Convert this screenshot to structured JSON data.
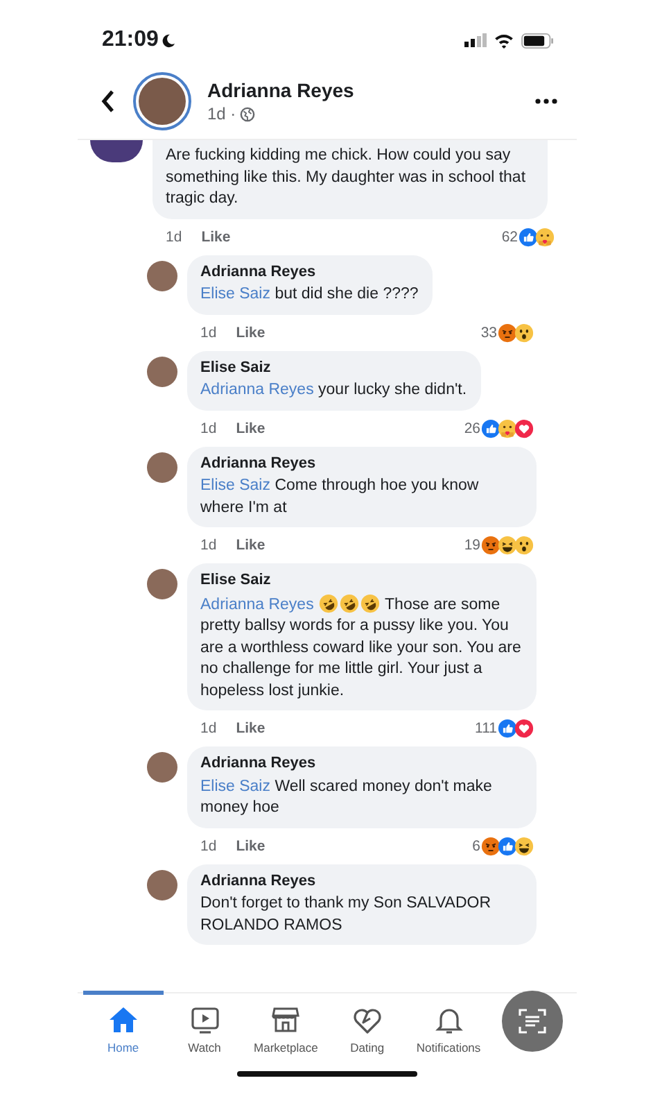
{
  "status_bar": {
    "time": "21:09"
  },
  "header": {
    "name": "Adrianna Reyes",
    "meta": "1d ·"
  },
  "comments": [
    {
      "kind": "comment",
      "text": "Are fucking kidding me chick. How could you say something like this. My daughter was in school that tragic day.",
      "time": "1d",
      "like": "Like",
      "count": "62",
      "reactions": [
        {
          "kind": "like"
        },
        {
          "kind": "care"
        }
      ]
    },
    {
      "kind": "reply",
      "author": "Adrianna Reyes",
      "mention": "Elise Saiz",
      "text": "but did she die ????",
      "time": "1d",
      "like": "Like",
      "count": "33",
      "reactions": [
        {
          "kind": "angry"
        },
        {
          "kind": "wow"
        }
      ]
    },
    {
      "kind": "reply",
      "author": "Elise Saiz",
      "mention": "Adrianna Reyes",
      "text": "your lucky she didn't.",
      "time": "1d",
      "like": "Like",
      "count": "26",
      "reactions": [
        {
          "kind": "like"
        },
        {
          "kind": "care"
        },
        {
          "kind": "love"
        }
      ]
    },
    {
      "kind": "reply",
      "author": "Adrianna Reyes",
      "mention": "Elise Saiz",
      "text": "Come through hoe you know where I'm at",
      "time": "1d",
      "like": "Like",
      "count": "19",
      "reactions": [
        {
          "kind": "angry"
        },
        {
          "kind": "haha"
        },
        {
          "kind": "wow"
        }
      ]
    },
    {
      "kind": "reply",
      "author": "Elise Saiz",
      "mention": "Adrianna Reyes",
      "inline_icons": [
        {
          "kind": "rofl"
        },
        {
          "kind": "rofl"
        },
        {
          "kind": "rofl"
        }
      ],
      "text": "Those are some pretty ballsy words for a pussy like you. You are a worthless coward like your son. You are no challenge for me little girl. Your just a hopeless lost junkie.",
      "time": "1d",
      "like": "Like",
      "count": "111",
      "reactions": [
        {
          "kind": "like"
        },
        {
          "kind": "love"
        }
      ]
    },
    {
      "kind": "reply",
      "author": "Adrianna Reyes",
      "mention": "Elise Saiz",
      "text": "Well scared money don't make money hoe",
      "time": "1d",
      "like": "Like",
      "count": "6",
      "reactions": [
        {
          "kind": "angry"
        },
        {
          "kind": "like"
        },
        {
          "kind": "haha"
        }
      ]
    },
    {
      "kind": "reply",
      "author": "Adrianna Reyes",
      "text": "Don't forget to thank my Son SALVADOR ROLANDO RAMOS"
    }
  ],
  "nav": [
    {
      "kind": "home",
      "label": "Home",
      "selected": true
    },
    {
      "kind": "watch",
      "label": "Watch",
      "selected": false
    },
    {
      "kind": "marketplace",
      "label": "Marketplace",
      "selected": false
    },
    {
      "kind": "dating",
      "label": "Dating",
      "selected": false
    },
    {
      "kind": "notifications",
      "label": "Notifications",
      "selected": false
    }
  ]
}
